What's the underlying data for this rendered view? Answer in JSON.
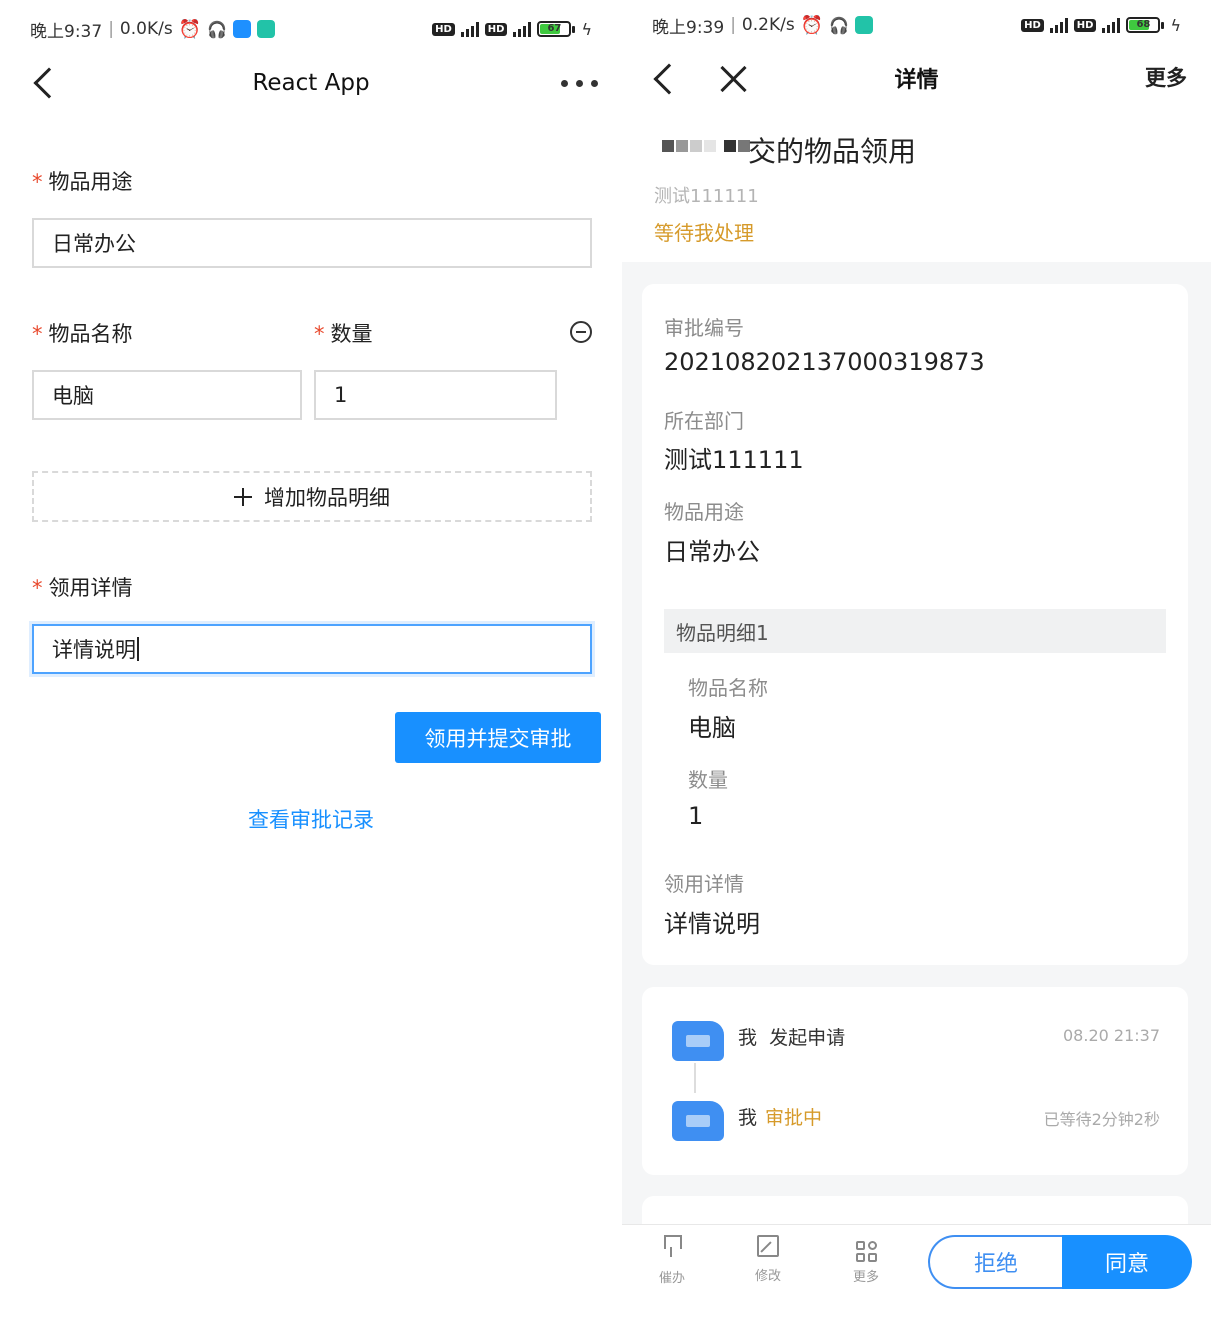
{
  "left": {
    "status": {
      "time": "晚上9:37",
      "speed": "0.0K/s",
      "battery": "67"
    },
    "header": {
      "title": "React App"
    },
    "form": {
      "purpose": {
        "label": "物品用途",
        "value": "日常办公"
      },
      "item_name": {
        "label": "物品名称",
        "value": "电脑"
      },
      "quantity": {
        "label": "数量",
        "value": "1"
      },
      "add_item_label": "增加物品明细",
      "detail": {
        "label": "领用详情",
        "value": "详情说明"
      },
      "required_mark": "*"
    },
    "submit_label": "领用并提交审批",
    "history_link": "查看审批记录"
  },
  "right": {
    "status": {
      "time": "晚上9:39",
      "speed": "0.2K/s",
      "battery": "68"
    },
    "header": {
      "title": "详情",
      "more": "更多"
    },
    "summary": {
      "title": "交的物品领用",
      "dept": "测试111111",
      "state": "等待我处理"
    },
    "details": {
      "approval_no_label": "审批编号",
      "approval_no": "202108202137000319873",
      "dept_label": "所在部门",
      "dept": "测试111111",
      "purpose_label": "物品用途",
      "purpose": "日常办公",
      "sub_title": "物品明细1",
      "item_name_label": "物品名称",
      "item_name": "电脑",
      "quantity_label": "数量",
      "quantity": "1",
      "detail_label": "领用详情",
      "detail": "详情说明"
    },
    "timeline": [
      {
        "actor": "我",
        "action": "发起申请",
        "time": "08.20 21:37"
      },
      {
        "actor": "我",
        "action": "审批中",
        "time": "已等待2分钟2秒"
      }
    ],
    "toolbar": {
      "urge": "催办",
      "edit": "修改",
      "more": "更多",
      "reject": "拒绝",
      "agree": "同意"
    }
  },
  "colors": {
    "primary": "#1890ff",
    "required": "#e8492d",
    "pending": "#d69a2a"
  }
}
